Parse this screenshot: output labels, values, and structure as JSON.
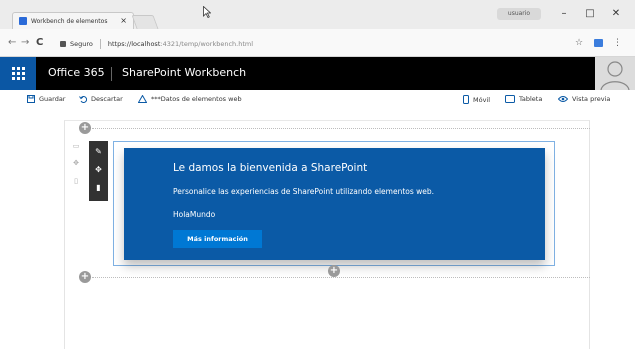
{
  "browser": {
    "tab_title": "Workbench de elementos",
    "tab_close": "×",
    "user_badge": "usuario",
    "minimize": "–",
    "maximize": "□",
    "close": "✕",
    "back": "←",
    "forward": "→",
    "reload": "C",
    "secure_label": "Seguro",
    "url_host": "https://localhost",
    "url_path": ":4321/temp/workbench.html",
    "star": "☆",
    "menu": "⋮"
  },
  "suite": {
    "brand": "Office 365",
    "app": "SharePoint Workbench"
  },
  "commands": {
    "save": "Guardar",
    "discard": "Descartar",
    "warning": "***Datos de elementos web",
    "mobile": "Móvil",
    "tablet": "Tableta",
    "preview": "Vista previa"
  },
  "webpart": {
    "title": "Le damos la bienvenida a SharePoint",
    "subtitle": "Personalice las experiencias de SharePoint utilizando elementos web.",
    "description": "HolaMundo",
    "button_label": "Más información"
  },
  "colors": {
    "webpart_bg": "#0b5aa6",
    "button_bg": "#0078d4",
    "suitebar": "#000000",
    "waffle": "#0b57a4"
  },
  "icons": {
    "edit": "pencil-icon",
    "move": "move-icon",
    "delete": "trash-icon"
  }
}
